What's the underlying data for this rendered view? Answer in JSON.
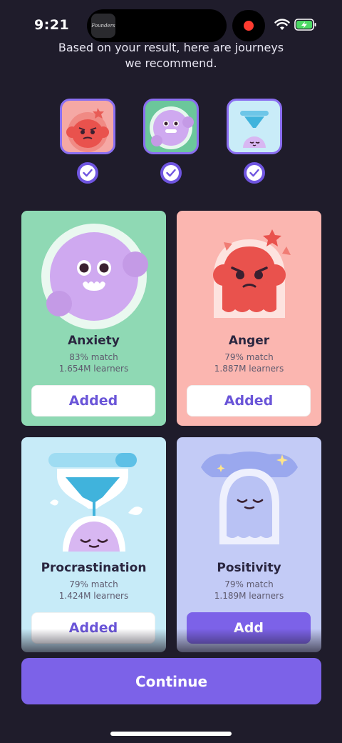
{
  "status_bar": {
    "time": "9:21",
    "island_thumb_label": "Founders",
    "recording_color": "#ff3b30"
  },
  "header": {
    "subtitle_line1": "Based on your result, here are journeys",
    "subtitle_line2": "we recommend."
  },
  "recommended": [
    {
      "icon": "anger-character-icon",
      "checked": true
    },
    {
      "icon": "anxiety-character-icon",
      "checked": true
    },
    {
      "icon": "procrastination-hourglass-icon",
      "checked": true
    }
  ],
  "cards": [
    {
      "title": "Anxiety",
      "match": "83% match",
      "learners": "1.654M learners",
      "button": "Added",
      "added": true,
      "bg": "#8fd9b4"
    },
    {
      "title": "Anger",
      "match": "79% match",
      "learners": "1.887M learners",
      "button": "Added",
      "added": true,
      "bg": "#fbb6b0"
    },
    {
      "title": "Procrastination",
      "match": "79% match",
      "learners": "1.424M learners",
      "button": "Added",
      "added": true,
      "bg": "#c7ebf8"
    },
    {
      "title": "Positivity",
      "match": "79% match",
      "learners": "1.189M learners",
      "button": "Add",
      "added": false,
      "bg": "#c3cbf6"
    }
  ],
  "continue_label": "Continue",
  "colors": {
    "background": "#1f1c2b",
    "accent": "#7c62e8"
  }
}
